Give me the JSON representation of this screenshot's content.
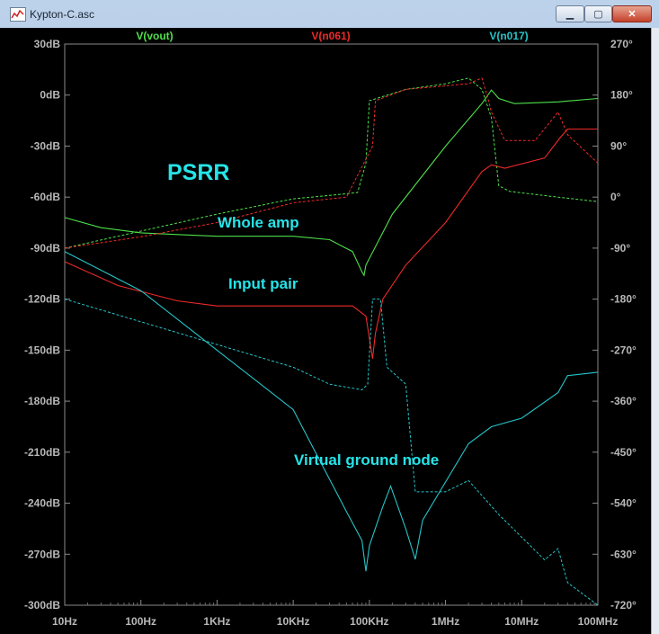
{
  "window": {
    "title": "Kypton-C.asc",
    "controls": {
      "minimize": "▁",
      "maximize": "▢",
      "close": "✕"
    }
  },
  "chart_data": {
    "type": "line",
    "x_scale": "log",
    "xlim": [
      10,
      100000000
    ],
    "x_ticks": [
      "10Hz",
      "100Hz",
      "1KHz",
      "10KHz",
      "100KHz",
      "1MHz",
      "10MHz",
      "100MHz"
    ],
    "left_axis": {
      "unit": "dB",
      "ylim": [
        -300,
        30
      ],
      "ticks": [
        "30dB",
        "0dB",
        "-30dB",
        "-60dB",
        "-90dB",
        "-120dB",
        "-150dB",
        "-180dB",
        "-210dB",
        "-240dB",
        "-270dB",
        "-300dB"
      ]
    },
    "right_axis": {
      "unit": "°",
      "ylim": [
        -720,
        270
      ],
      "ticks": [
        "270°",
        "180°",
        "90°",
        "0°",
        "-90°",
        "-180°",
        "-270°",
        "-360°",
        "-450°",
        "-540°",
        "-630°",
        "-720°"
      ]
    },
    "grid": false,
    "legend": {
      "placement": "top",
      "entries": [
        "V(vout)",
        "V(n061)",
        "V(n017)"
      ]
    },
    "annotations": {
      "title": "PSRR",
      "whole_amp": "Whole amp",
      "input_pair": "Input pair",
      "virtual_ground": "Virtual ground node"
    },
    "series": [
      {
        "name": "V(vout)",
        "color": "#4ee04a",
        "magnitude_db": [
          [
            10,
            -72
          ],
          [
            30,
            -78
          ],
          [
            100,
            -81
          ],
          [
            300,
            -82
          ],
          [
            1000,
            -83
          ],
          [
            10000,
            -83
          ],
          [
            30000,
            -85
          ],
          [
            60000,
            -92
          ],
          [
            80000,
            -104
          ],
          [
            85000,
            -106
          ],
          [
            90000,
            -100
          ],
          [
            200000,
            -70
          ],
          [
            1000000,
            -30
          ],
          [
            3000000,
            -5
          ],
          [
            4000000,
            3
          ],
          [
            5000000,
            -2
          ],
          [
            8000000,
            -5
          ],
          [
            30000000,
            -4
          ],
          [
            100000000,
            -2
          ]
        ],
        "phase_deg": [
          [
            10,
            -90
          ],
          [
            100,
            -60
          ],
          [
            1000,
            -30
          ],
          [
            10000,
            -3
          ],
          [
            30000,
            3
          ],
          [
            70000,
            8
          ],
          [
            90000,
            60
          ],
          [
            100000,
            170
          ],
          [
            300000,
            190
          ],
          [
            1000000,
            200
          ],
          [
            2000000,
            210
          ],
          [
            3000000,
            190
          ],
          [
            4000000,
            140
          ],
          [
            5000000,
            20
          ],
          [
            7000000,
            10
          ],
          [
            30000000,
            0
          ],
          [
            100000000,
            -8
          ]
        ]
      },
      {
        "name": "V(n061)",
        "color": "#ee2a2a",
        "magnitude_db": [
          [
            10,
            -98
          ],
          [
            50,
            -112
          ],
          [
            300,
            -121
          ],
          [
            1000,
            -124
          ],
          [
            10000,
            -124
          ],
          [
            60000,
            -124
          ],
          [
            90000,
            -130
          ],
          [
            110000,
            -155
          ],
          [
            120000,
            -140
          ],
          [
            150000,
            -120
          ],
          [
            300000,
            -100
          ],
          [
            1000000,
            -75
          ],
          [
            3000000,
            -45
          ],
          [
            4000000,
            -41
          ],
          [
            6000000,
            -43
          ],
          [
            20000000,
            -37
          ],
          [
            32000000,
            -25
          ],
          [
            40000000,
            -20
          ],
          [
            100000000,
            -20
          ]
        ],
        "phase_deg": [
          [
            10,
            -90
          ],
          [
            100,
            -70
          ],
          [
            1000,
            -45
          ],
          [
            10000,
            -10
          ],
          [
            50000,
            0
          ],
          [
            110000,
            90
          ],
          [
            120000,
            170
          ],
          [
            300000,
            190
          ],
          [
            2000000,
            200
          ],
          [
            3000000,
            210
          ],
          [
            3500000,
            180
          ],
          [
            4000000,
            150
          ],
          [
            6000000,
            100
          ],
          [
            15000000,
            100
          ],
          [
            30000000,
            150
          ],
          [
            40000000,
            110
          ],
          [
            100000000,
            60
          ]
        ]
      },
      {
        "name": "V(n017)",
        "color": "#26c4c8",
        "magnitude_db": [
          [
            10,
            -92
          ],
          [
            100,
            -115
          ],
          [
            1000,
            -150
          ],
          [
            10000,
            -185
          ],
          [
            50000,
            -245
          ],
          [
            80000,
            -262
          ],
          [
            90000,
            -280
          ],
          [
            100000,
            -265
          ],
          [
            150000,
            -242
          ],
          [
            190000,
            -230
          ],
          [
            300000,
            -255
          ],
          [
            400000,
            -273
          ],
          [
            500000,
            -250
          ],
          [
            2000000,
            -205
          ],
          [
            4000000,
            -195
          ],
          [
            10000000,
            -190
          ],
          [
            30000000,
            -175
          ],
          [
            40000000,
            -165
          ],
          [
            100000000,
            -163
          ]
        ],
        "phase_deg": [
          [
            10,
            -180
          ],
          [
            100,
            -220
          ],
          [
            1000,
            -260
          ],
          [
            10000,
            -300
          ],
          [
            30000,
            -330
          ],
          [
            80000,
            -340
          ],
          [
            95000,
            -330
          ],
          [
            110000,
            -180
          ],
          [
            140000,
            -180
          ],
          [
            170000,
            -300
          ],
          [
            300000,
            -330
          ],
          [
            400000,
            -520
          ],
          [
            1000000,
            -520
          ],
          [
            2000000,
            -500
          ],
          [
            5000000,
            -560
          ],
          [
            20000000,
            -640
          ],
          [
            30000000,
            -620
          ],
          [
            40000000,
            -680
          ],
          [
            100000000,
            -720
          ]
        ]
      }
    ]
  }
}
